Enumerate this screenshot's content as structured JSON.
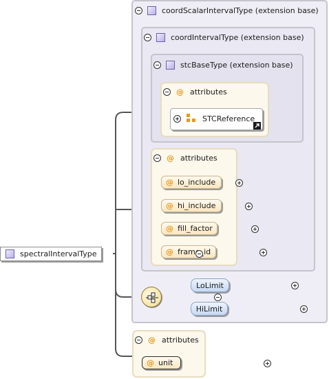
{
  "root": {
    "name": "spectralIntervalType"
  },
  "extensions": [
    {
      "label": "coordScalarIntervalType (extension base)"
    },
    {
      "label": "coordIntervalType (extension base)"
    },
    {
      "label": "stcBaseType (extension base)"
    }
  ],
  "stc_attributes": {
    "label": "attributes",
    "reference": "STCReference"
  },
  "interval_attributes": {
    "label": "attributes",
    "items": [
      "lo_include",
      "hi_include",
      "fill_factor",
      "frame_id"
    ]
  },
  "choice_elements": [
    "LoLimit",
    "HiLimit"
  ],
  "unit_attributes": {
    "label": "attributes",
    "items": [
      "unit"
    ]
  },
  "icons": {
    "type": "complex-type-icon",
    "attribute": "attribute-at-icon",
    "reference": "reference-arrow-icon",
    "sequence": "sequence-compositor-icon",
    "expand": "plus-toggle-icon",
    "collapse": "minus-toggle-icon"
  },
  "colors": {
    "extension_bg": "#efeef6",
    "attribute_bg": "#fdf8ec",
    "element_bg": "#c6d9f3",
    "accent": "#e39a1c"
  }
}
